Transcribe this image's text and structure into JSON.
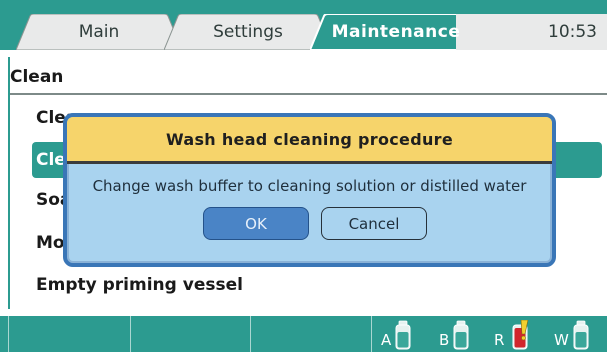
{
  "tabs": [
    {
      "label": "Main"
    },
    {
      "label": "Settings"
    },
    {
      "label": "Maintenance"
    }
  ],
  "clock": "10:53",
  "content": {
    "title": "Clean",
    "items": [
      {
        "label": "Clea"
      },
      {
        "label": "Clea"
      },
      {
        "label": "Soak"
      },
      {
        "label": "Mov"
      },
      {
        "label": "Empty priming vessel"
      }
    ]
  },
  "dialog": {
    "title": "Wash head cleaning procedure",
    "message": "Change wash buffer to cleaning solution or distilled water",
    "ok_label": "OK",
    "cancel_label": "Cancel"
  },
  "bottles": [
    {
      "letter": "A",
      "state": "normal",
      "color": "#3aa79a"
    },
    {
      "letter": "B",
      "state": "normal",
      "color": "#3aa79a"
    },
    {
      "letter": "R",
      "state": "warning",
      "color": "#d1272d"
    },
    {
      "letter": "W",
      "state": "normal",
      "color": "#3aa79a"
    }
  ],
  "colors": {
    "teal": "#2c9b90",
    "dialog_bg": "#a9d3ef",
    "dialog_header": "#f6d46b",
    "warning": "#f3d02f"
  }
}
